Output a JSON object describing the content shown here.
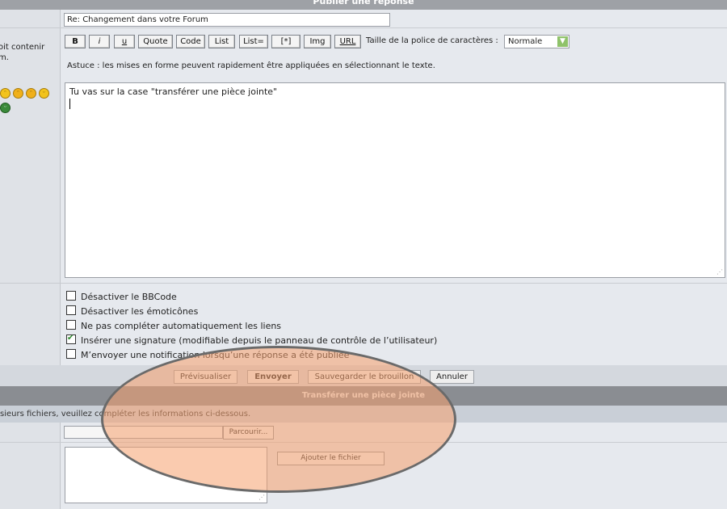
{
  "form": {
    "header_title": "Publier une réponse",
    "subject_value": "Re: Changement dans votre Forum",
    "left_hint_line1": "oit contenir",
    "left_hint_line2": "m.",
    "toolbar": [
      "B",
      "i",
      "u",
      "Quote",
      "Code",
      "List",
      "List=",
      "[*]",
      "Img",
      "URL"
    ],
    "font_size_label": "Taille de la police de caractères :",
    "font_size_value": "Normale",
    "tip": "Astuce : les mises en forme peuvent rapidement être appliquées en sélectionnant le texte.",
    "message_text": "Tu vas sur la case \"transférer une pièce jointe\""
  },
  "options": [
    {
      "label": "Désactiver le BBCode",
      "checked": false
    },
    {
      "label": "Désactiver les émoticônes",
      "checked": false
    },
    {
      "label": "Ne pas compléter automatiquement les liens",
      "checked": false
    },
    {
      "label": "Insérer une signature (modifiable depuis le panneau de contrôle de l’utilisateur)",
      "checked": true
    },
    {
      "label": "M’envoyer une notification lorsqu’une réponse a été publiée",
      "checked": false
    }
  ],
  "actions": {
    "preview": "Prévisualiser",
    "send": "Envoyer",
    "save_draft": "Sauvegarder le brouillon",
    "cancel": "Annuler"
  },
  "attachment": {
    "title": "Transférer une pièce jointe",
    "info": "sieurs fichiers, veuillez compléter les informations ci-dessous.",
    "browse": "Parcourir...",
    "add_file": "Ajouter le fichier"
  },
  "colors": {
    "highlight_ellipse": "#f5a06e",
    "checkbox_check": "#2c8a2c"
  }
}
